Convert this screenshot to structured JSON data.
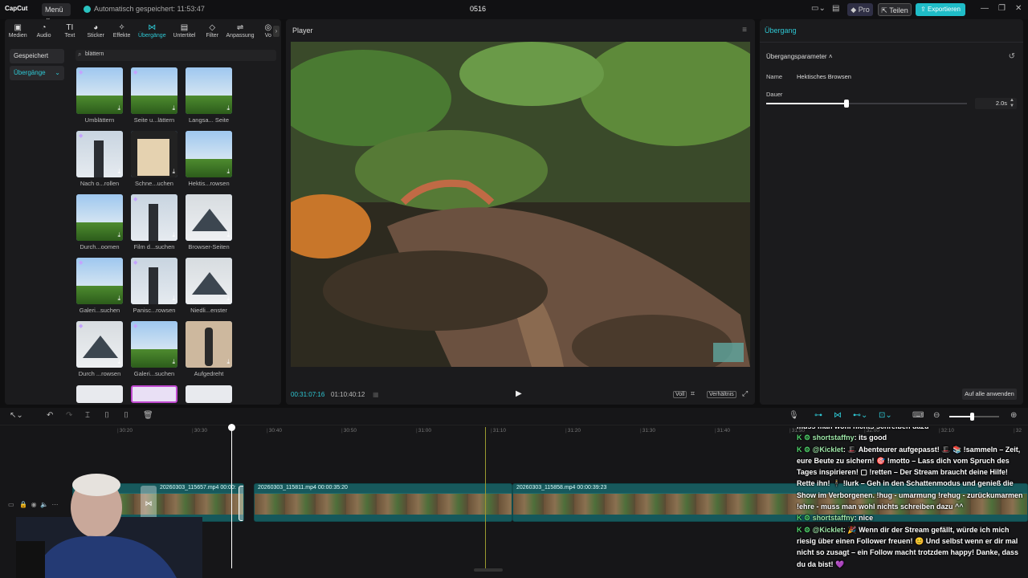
{
  "titlebar": {
    "logo": "CapCut",
    "menu": "Menü",
    "autosave": "Automatisch gespeichert: 11:53:47",
    "project": "0516",
    "pro": "Pro",
    "share": "Teilen",
    "export": "Exportieren"
  },
  "tools": [
    {
      "label": "Medien",
      "icon": "media-icon",
      "glyph": "▣"
    },
    {
      "label": "Audio",
      "icon": "audio-icon",
      "glyph": "◔"
    },
    {
      "label": "Text",
      "icon": "text-icon",
      "glyph": "TI"
    },
    {
      "label": "Sticker",
      "icon": "sticker-icon",
      "glyph": "◕"
    },
    {
      "label": "Effekte",
      "icon": "effects-icon",
      "glyph": "✧"
    },
    {
      "label": "Übergänge",
      "icon": "transitions-icon",
      "glyph": "⋈"
    },
    {
      "label": "Untertitel",
      "icon": "subtitles-icon",
      "glyph": "▤"
    },
    {
      "label": "Filter",
      "icon": "filter-icon",
      "glyph": "◇"
    },
    {
      "label": "Anpassung",
      "icon": "adjust-icon",
      "glyph": "⇌"
    },
    {
      "label": "Vo",
      "icon": "vo-icon",
      "glyph": "◎"
    }
  ],
  "categories": {
    "saved": "Gespeichert",
    "transitions": "Übergänge"
  },
  "search": {
    "value": "blättern"
  },
  "transitions": [
    {
      "label": "Umblättern"
    },
    {
      "label": "Seite u...lättern"
    },
    {
      "label": "Langsa... Seite"
    },
    {
      "label": "Nach o...rollen"
    },
    {
      "label": "Schne...uchen"
    },
    {
      "label": "Hektis...rowsen"
    },
    {
      "label": "Durch...oomen"
    },
    {
      "label": "Film d...suchen"
    },
    {
      "label": "Browser-Seiten"
    },
    {
      "label": "Galeri...suchen"
    },
    {
      "label": "Panisc...rowsen"
    },
    {
      "label": "Niedli...enster"
    },
    {
      "label": "Durch ...rowsen"
    },
    {
      "label": "Galeri...suchen"
    },
    {
      "label": "Aufgedreht"
    }
  ],
  "player": {
    "title": "Player",
    "current": "00:31:07:16",
    "total": "01:10:40:12",
    "full": "Voll",
    "ratio": "Verhältnis"
  },
  "inspector": {
    "title": "Übergang",
    "section": "Übergangsparameter",
    "name_label": "Name",
    "name_value": "Hektisches Browsen",
    "duration_label": "Dauer",
    "duration_value": "2.0s",
    "duration_fraction": 0.4,
    "apply_all": "Auf alle anwenden"
  },
  "timeline": {
    "ticks": [
      "30:20",
      "30:30",
      "30:40",
      "30:50",
      "31:00",
      "31:10",
      "31:20",
      "31:30",
      "31:40",
      "31:50",
      "32:00",
      "32:10",
      "32"
    ],
    "clips": [
      {
        "name": "20260303_115657.mp4",
        "duration": "00:00:"
      },
      {
        "name": "20260303_115811.mp4",
        "duration": "00:00:35:20"
      },
      {
        "name": "20260303_115858.mp4",
        "duration": "00:00:39:23"
      }
    ]
  },
  "chat": [
    {
      "user": "",
      "text": "muss man wohl nichts schreiben dazu"
    },
    {
      "user": "shortstaffny",
      "text": ": its good"
    },
    {
      "user": "@Kicklet",
      "text": ": 🎩 Abenteurer aufgepasst! 🎩 📚 !sammeln – Zeit, eure Beute zu sichern! 🎯 !motto – Lass dich vom Spruch des Tages inspirieren! ▢ !retten – Der Stream braucht deine Hilfe! Rette ihn! 🕴 !lurk – Geh in den Schattenmodus und genieß die Show im Verborgenen. !hug - umarmung !rehug - zurückumarmen !ehre - muss man wohl nichts schreiben dazu ^^"
    },
    {
      "user": "shortstaffny",
      "text": ": nice"
    },
    {
      "user": "@Kicklet",
      "text": ": 🎉 Wenn dir der Stream gefällt, würde ich mich riesig über einen Follower freuen! 😊 Und selbst wenn er dir mal nicht so zusagt – ein Follow macht trotzdem happy! Danke, dass du da bist! 💜"
    }
  ]
}
